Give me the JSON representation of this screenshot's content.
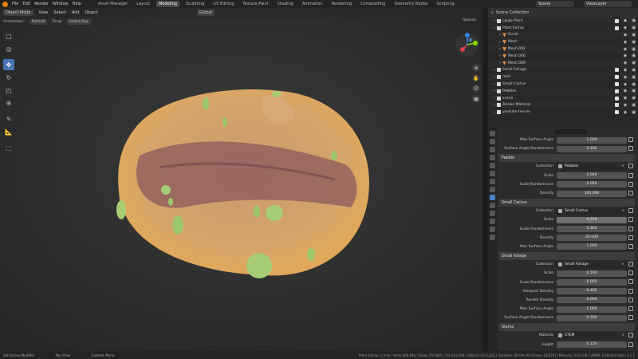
{
  "menubar": {
    "items": [
      "File",
      "Edit",
      "Render",
      "Window",
      "Help"
    ],
    "workspaces": [
      "Asset Manager",
      "Layout",
      "Modeling",
      "Sculpting",
      "UV Editing",
      "Texture Paint",
      "Shading",
      "Animation",
      "Rendering",
      "Compositing",
      "Geometry Nodes",
      "Scripting"
    ],
    "active_workspace": "Modeling",
    "scene": "Scene",
    "view_layer": "ViewLayer"
  },
  "viewport": {
    "mode": "Object Mode",
    "menus": [
      "View",
      "Select",
      "Add",
      "Object"
    ],
    "transform_orientation": "Global",
    "orientation_label": "Orientation:",
    "orientation_value": "Default",
    "drag_label": "Drag:",
    "drag_value": "Select Box",
    "options_label": "Options",
    "tools": [
      "select-box-icon",
      "cursor-icon",
      "move-icon",
      "rotate-icon",
      "scale-icon",
      "transform-icon",
      "annotate-icon",
      "measure-icon",
      "add-cube-icon"
    ],
    "active_tool": "move-icon",
    "nav_buttons": [
      "zoom-icon",
      "hand-icon",
      "camera-icon",
      "grid-icon"
    ],
    "gizmo_colors": {
      "x": "#e4424e",
      "y": "#8bdc00",
      "z": "#2f83e3"
    }
  },
  "outliner": {
    "title": "Scene Collection",
    "rows": [
      {
        "label": "Large Plant",
        "indent": 1,
        "icon": "collection-icon"
      },
      {
        "label": "Plant Extras",
        "indent": 1,
        "icon": "collection-icon"
      },
      {
        "label": "Circle",
        "indent": 2,
        "icon": "mesh-icon"
      },
      {
        "label": "Mesh",
        "indent": 2,
        "icon": "mesh-icon"
      },
      {
        "label": "Mesh.002",
        "indent": 2,
        "icon": "mesh-icon"
      },
      {
        "label": "Mesh.006",
        "indent": 2,
        "icon": "mesh-icon"
      },
      {
        "label": "Mesh.009",
        "indent": 2,
        "icon": "mesh-icon"
      },
      {
        "label": "Small Foliage",
        "indent": 1,
        "icon": "collection-icon"
      },
      {
        "label": "rock",
        "indent": 1,
        "icon": "collection-icon"
      },
      {
        "label": "Small Cactus",
        "indent": 1,
        "icon": "collection-icon"
      },
      {
        "label": "Pebbles",
        "indent": 1,
        "icon": "collection-icon"
      },
      {
        "label": "scene",
        "indent": 1,
        "icon": "collection-icon"
      },
      {
        "label": "Terrain Material",
        "indent": 1,
        "icon": "collection-icon"
      },
      {
        "label": "youtube terrain",
        "indent": 1,
        "icon": "collection-icon"
      }
    ]
  },
  "properties": {
    "rows": [
      {
        "kind": "field",
        "label": "Max Surface Angle",
        "value": "1.000"
      },
      {
        "kind": "field",
        "label": "Surface Angle Randomness",
        "value": "0.100"
      },
      {
        "kind": "section",
        "label": "Pebble"
      },
      {
        "kind": "object",
        "label": "Collection",
        "value": "Pebbles"
      },
      {
        "kind": "field",
        "label": "Scale",
        "value": "0.040"
      },
      {
        "kind": "field",
        "label": "Scale Randomness",
        "value": "0.050"
      },
      {
        "kind": "field",
        "label": "Density",
        "value": "100.000"
      },
      {
        "kind": "section",
        "label": "Small Cactus"
      },
      {
        "kind": "object",
        "label": "Collection",
        "value": "Small Cactus"
      },
      {
        "kind": "field",
        "label": "Scale",
        "value": "0.250",
        "hl": true
      },
      {
        "kind": "field",
        "label": "Scale Randomness",
        "value": "0.300"
      },
      {
        "kind": "field",
        "label": "Density",
        "value": "20.000"
      },
      {
        "kind": "field",
        "label": "Max Surface Angle",
        "value": "1.000"
      },
      {
        "kind": "section",
        "label": "Small foliage"
      },
      {
        "kind": "object",
        "label": "Collection",
        "value": "Small Foliage"
      },
      {
        "kind": "field",
        "label": "Scale",
        "value": "0.100"
      },
      {
        "kind": "field",
        "label": "Scale Randomness",
        "value": "0.050"
      },
      {
        "kind": "field",
        "label": "Viewport Density",
        "value": "0.400"
      },
      {
        "kind": "field",
        "label": "Render Density",
        "value": "0.000"
      },
      {
        "kind": "field",
        "label": "Max Surface Angle",
        "value": "1.000"
      },
      {
        "kind": "field",
        "label": "Surface Angle Randomness",
        "value": "0.500"
      },
      {
        "kind": "section",
        "label": "Stems"
      },
      {
        "kind": "object",
        "label": "Material",
        "value": "STEM"
      },
      {
        "kind": "field",
        "label": "Height",
        "value": "0.150"
      }
    ]
  },
  "statusbar": {
    "items": [
      "Set Active Modifier",
      "Pan View",
      "Context Menu"
    ],
    "stats": "Plant Extras | Circle | Verts:309,944 | Faces:307,805 | Tris:563,304 | Objects:0/13,412 | Duration: 00:09+04 (Frame 10/220) | Memory: 4.64 GiB | VRAM: 10.8/16.0 GiB | 4.1.1"
  }
}
